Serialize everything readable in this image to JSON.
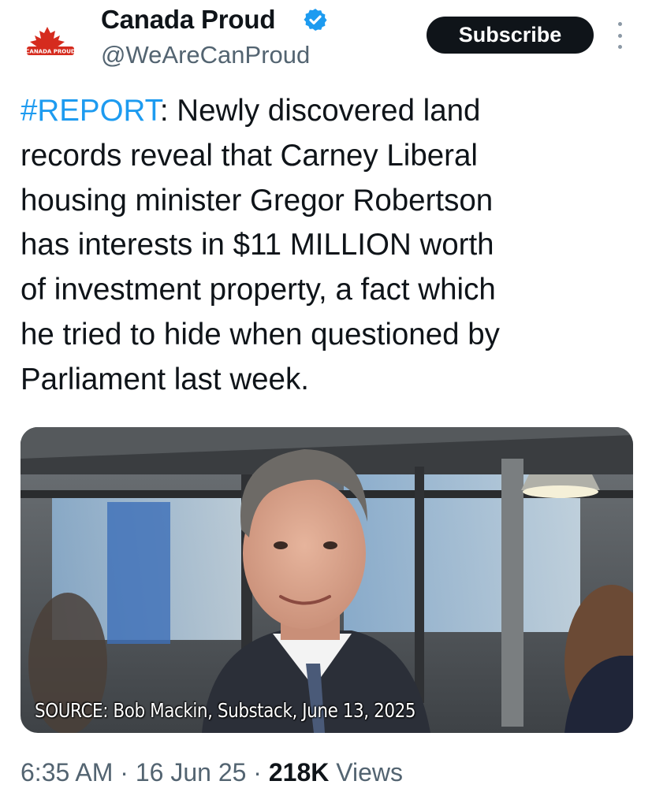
{
  "author": {
    "display_name": "Canada Proud",
    "handle": "@WeAreCanProud",
    "avatar_text": "CANADA PROUD",
    "verified": true
  },
  "actions": {
    "subscribe_label": "Subscribe",
    "more_icon": "more-vertical-icon"
  },
  "tweet": {
    "hashtag": "#REPORT",
    "text": ": Newly discovered land\nrecords reveal that Carney Liberal\nhousing minister Gregor Robertson\nhas interests in $11 MILLION worth\nof investment property, a fact which\nhe tried to hide when questioned by\nParliament last week."
  },
  "media": {
    "caption": "SOURCE: Bob Mackin, Substack, June 13, 2025"
  },
  "meta": {
    "time": "6:35 AM",
    "separator": " · ",
    "date": "16 Jun 25",
    "views_count": "218K",
    "views_label": " Views"
  },
  "colors": {
    "link": "#1d9bf0",
    "text": "#0f1419",
    "secondary": "#536471",
    "button_bg": "#0f1419",
    "brand_red": "#d52b1e"
  }
}
